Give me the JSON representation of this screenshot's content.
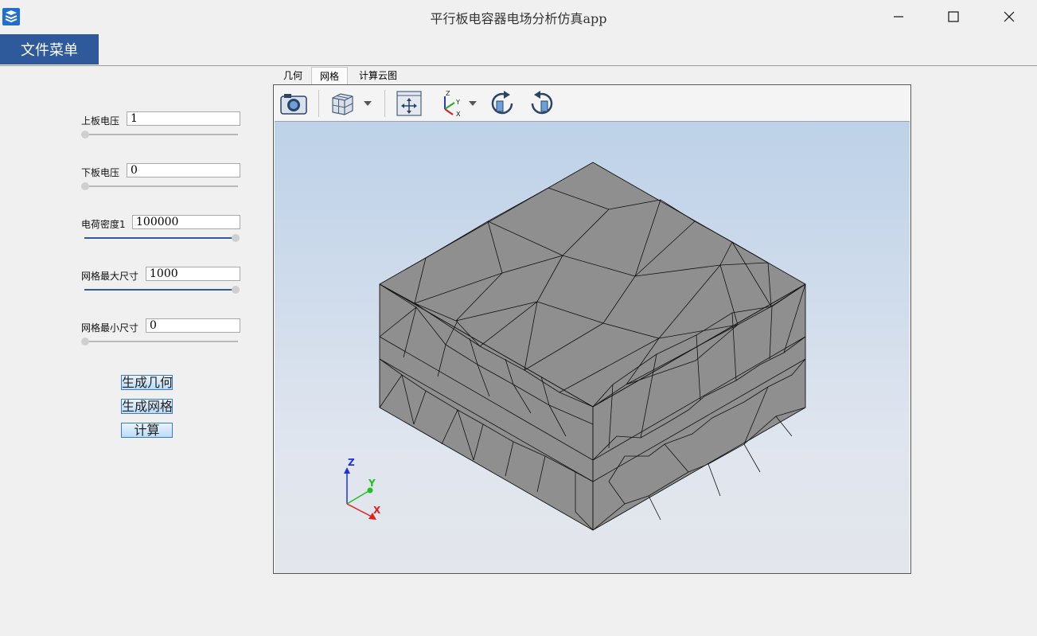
{
  "window": {
    "title": "平行板电容器电场分析仿真app",
    "icon": "app-stack-icon",
    "controls": [
      "minimize-icon",
      "maximize-icon",
      "close-icon"
    ]
  },
  "menu": {
    "file_label": "文件菜单"
  },
  "params": {
    "upper_voltage": {
      "label": "上板电压",
      "value": "1",
      "slider_fraction": 0.0
    },
    "lower_voltage": {
      "label": "下板电压",
      "value": "0",
      "slider_fraction": 0.0
    },
    "charge_density": {
      "label": "电荷密度1",
      "value": "100000",
      "slider_fraction": 1.0
    },
    "mesh_max": {
      "label": "网格最大尺寸",
      "value": "1000",
      "slider_fraction": 1.0
    },
    "mesh_min": {
      "label": "网格最小尺寸",
      "value": "0",
      "slider_fraction": 0.0
    }
  },
  "actions": {
    "gen_geometry": "生成几何",
    "gen_mesh": "生成网格",
    "compute": "计算"
  },
  "tabs": [
    {
      "label": "几何",
      "active": false
    },
    {
      "label": "网格",
      "active": true
    },
    {
      "label": "计算云图",
      "active": false
    }
  ],
  "toolbar": {
    "icons": [
      "camera-icon",
      "view-cube-icon",
      "dropdown-arrow-icon",
      "fit-view-icon",
      "axes-orientation-icon",
      "dropdown-arrow-icon",
      "rotate-cw-icon",
      "rotate-ccw-icon"
    ]
  },
  "triad": {
    "x": "X",
    "y": "Y",
    "z": "Z",
    "colors": {
      "x": "#e02020",
      "y": "#20c020",
      "z": "#2030e0"
    }
  },
  "colors": {
    "menu_bg": "#2e5a9c",
    "mesh_face": "#8f8f8f",
    "slider_fill": "#2e5a9c"
  }
}
